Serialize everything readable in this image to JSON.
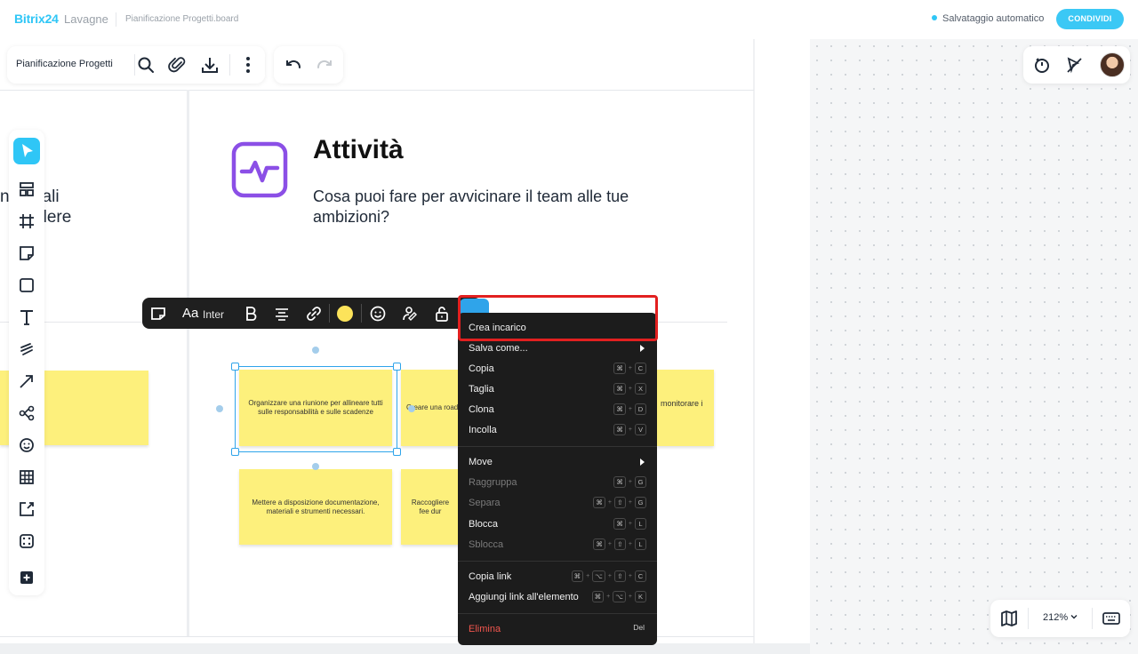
{
  "topbar": {
    "brand": "Bitrix24",
    "brand_sub": "Lavagne",
    "file_title": "Pianificazione Progetti.board",
    "autosave": "Salvataggio automatico",
    "share": "CONDIVIDI"
  },
  "header_toolbar": {
    "board_name": "Pianificazione Progetti",
    "icons": [
      "search-icon",
      "attach-icon",
      "download-icon",
      "more-icon",
      "undo-icon",
      "redo-icon"
    ]
  },
  "right_toolbar": {
    "icons": [
      "timer-icon",
      "hide-cursors-icon",
      "avatar"
    ]
  },
  "left_toolbar": {
    "tools": [
      "select-icon",
      "template-icon",
      "frame-icon",
      "sticky-note-icon",
      "shape-icon",
      "text-icon",
      "pen-icon",
      "arrow-icon",
      "mindmap-icon",
      "sticker-icon",
      "table-icon",
      "image-upload-icon",
      "dice-icon",
      "add-icon"
    ]
  },
  "board": {
    "left_fragment_line1": "n  entali",
    "left_fragment_line2": "  a  ndere",
    "section_title": "Attività",
    "section_subtitle": "Cosa puoi fare per avvicinare il team alle tue ambizioni?",
    "stickies": [
      {
        "text": "Organizzare una riunione per allineare tutti sulle responsabilità e sulle scadenze"
      },
      {
        "text": "Creare una road"
      },
      {
        "text": "monitorare i"
      },
      {
        "text": "Mettere a disposizione documentazione, materiali e strumenti necessari."
      },
      {
        "text": "Raccogliere fee dur"
      },
      {
        "text": ""
      }
    ]
  },
  "format_toolbar": {
    "font_glyph": "Aa",
    "font_name": "Inter",
    "sticky_color": "#fce35a"
  },
  "context_menu": {
    "items": [
      {
        "label": "Crea incarico",
        "shortcut": [],
        "disabled": false
      },
      {
        "label": "Salva come...",
        "submenu": true
      },
      {
        "label": "Copia",
        "shortcut": [
          "⌘",
          "C"
        ]
      },
      {
        "label": "Taglia",
        "shortcut": [
          "⌘",
          "X"
        ]
      },
      {
        "label": "Clona",
        "shortcut": [
          "⌘",
          "D"
        ]
      },
      {
        "label": "Incolla",
        "shortcut": [
          "⌘",
          "V"
        ]
      },
      {
        "label": "Move",
        "submenu": true
      },
      {
        "label": "Raggruppa",
        "shortcut": [
          "⌘",
          "G"
        ],
        "disabled": true
      },
      {
        "label": "Separa",
        "shortcut": [
          "⌘",
          "⇧",
          "G"
        ],
        "disabled": true
      },
      {
        "label": "Blocca",
        "shortcut": [
          "⌘",
          "L"
        ]
      },
      {
        "label": "Sblocca",
        "shortcut": [
          "⌘",
          "⇧",
          "L"
        ],
        "disabled": true
      },
      {
        "label": "Copia link",
        "shortcut": [
          "⌘",
          "⌥",
          "⇧",
          "C"
        ]
      },
      {
        "label": "Aggiungi link all'elemento",
        "shortcut": [
          "⌘",
          "⌥",
          "K"
        ]
      },
      {
        "label": "Elimina",
        "shortcut": [
          "Del"
        ],
        "danger": true
      }
    ]
  },
  "zoom_bar": {
    "zoom": "212%",
    "icons": [
      "map-icon",
      "chevron-down-icon",
      "keyboard-icon"
    ]
  },
  "colors": {
    "accent": "#2fc6f6",
    "sticky": "#fdf07c",
    "selection": "#2fa4ea",
    "menu_bg": "#1c1c1c",
    "danger": "#f2564e",
    "highlight": "#e22020"
  }
}
